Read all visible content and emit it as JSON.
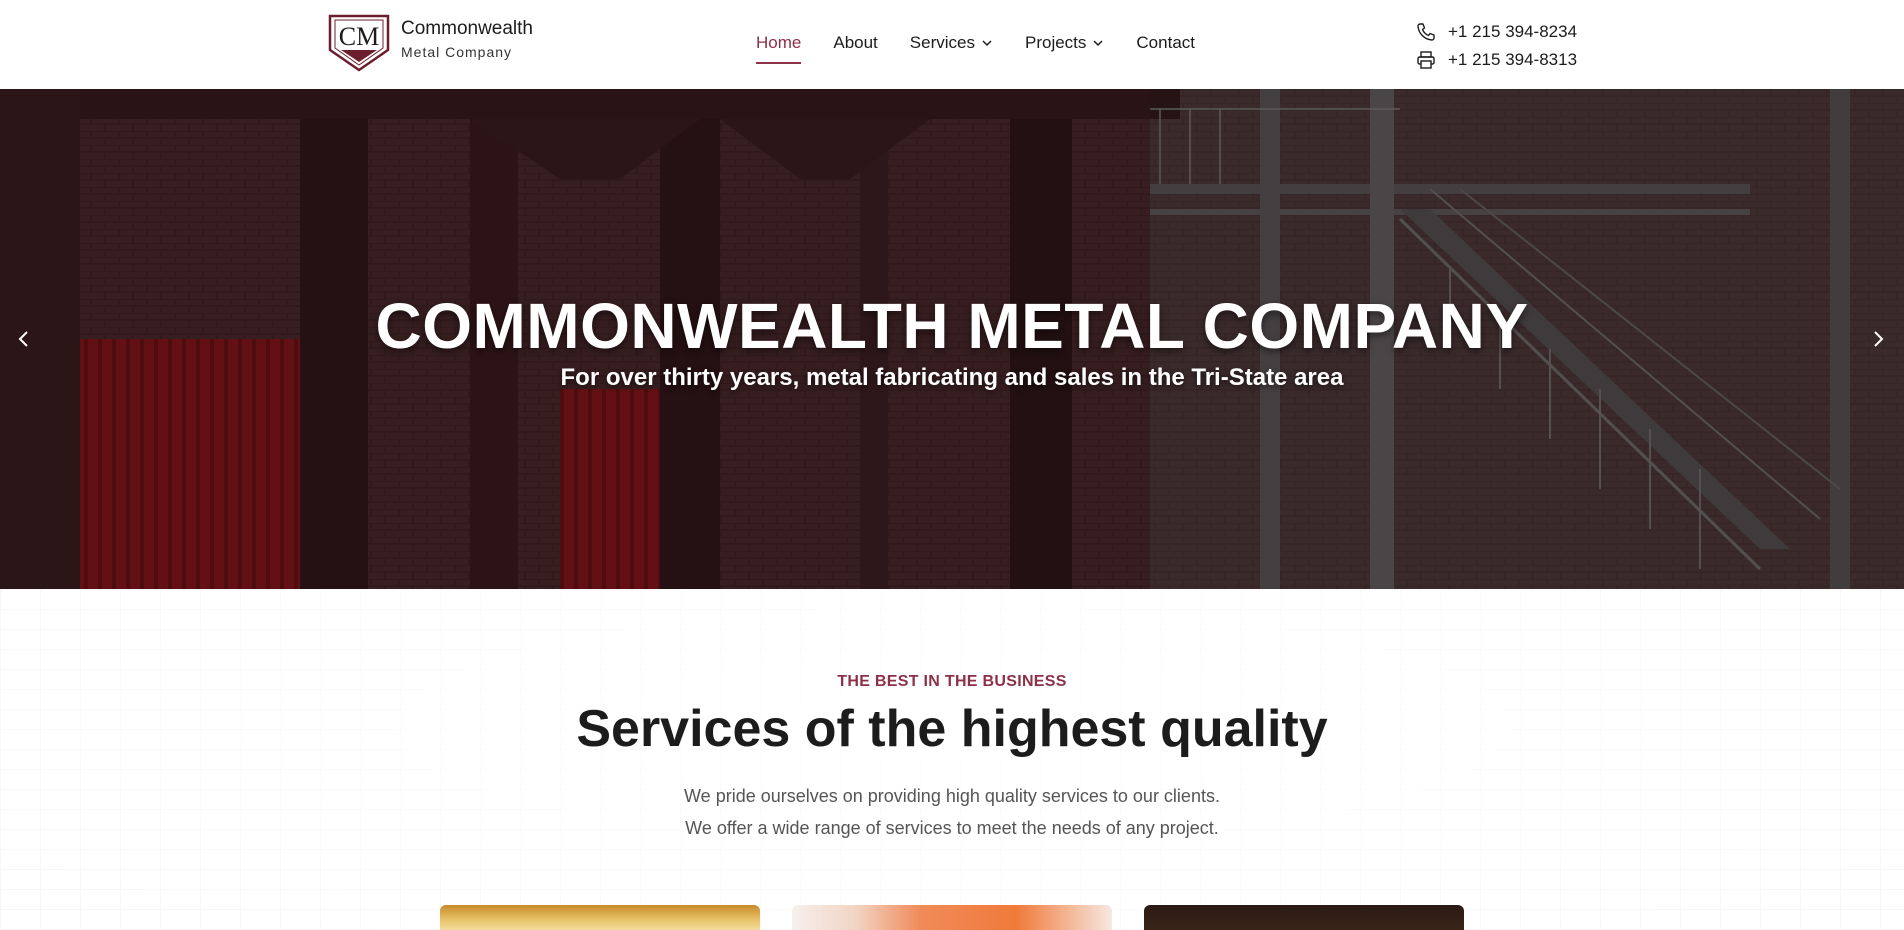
{
  "header": {
    "logo_name": "Commonwealth",
    "logo_sub": "Metal Company",
    "logo_mark": "CM"
  },
  "nav": {
    "items": [
      {
        "label": "Home",
        "active": true
      },
      {
        "label": "About"
      },
      {
        "label": "Services",
        "dropdown": true
      },
      {
        "label": "Projects",
        "dropdown": true
      },
      {
        "label": "Contact"
      }
    ]
  },
  "contacts": {
    "phone": "+1 215 394-8234",
    "fax": "+1 215 394-8313",
    "phone_icon": "phone-icon",
    "fax_icon": "printer-icon"
  },
  "hero": {
    "title": "COMMONWEALTH METAL COMPANY",
    "subtitle": "For over thirty years, metal fabricating and sales in the Tri-State area"
  },
  "services": {
    "eyebrow": "THE BEST IN THE BUSINESS",
    "title": "Services of the highest quality",
    "desc_line1": "We pride ourselves on providing high quality services to our clients.",
    "desc_line2": "We offer a wide range of services to meet the needs of any project."
  },
  "colors": {
    "accent": "#8d3048",
    "text": "#1c1c1c"
  }
}
